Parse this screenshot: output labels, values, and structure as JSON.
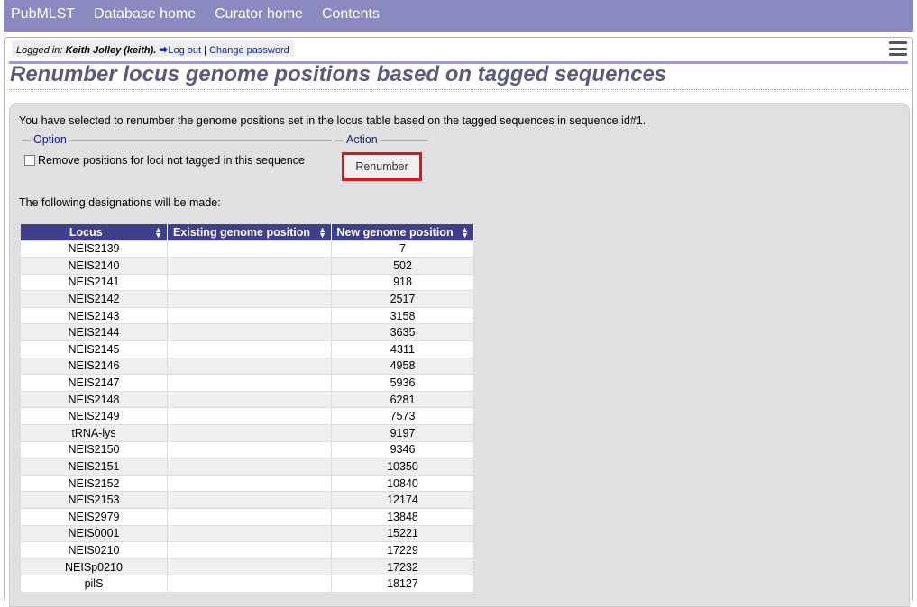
{
  "nav": {
    "items": [
      "PubMLST",
      "Database home",
      "Curator home",
      "Contents"
    ]
  },
  "login": {
    "label": "Logged in:",
    "user": "Keith Jolley (keith).",
    "logout": "Log out",
    "separator": "|",
    "change_password": "Change password"
  },
  "page_title": "Renumber locus genome positions based on tagged sequences",
  "intro_text": "You have selected to renumber the genome positions set in the locus table based on the tagged sequences in sequence id#1.",
  "option": {
    "legend": "Option",
    "checkbox_label": "Remove positions for loci not tagged in this sequence",
    "checked": false
  },
  "action": {
    "legend": "Action",
    "button_label": "Renumber"
  },
  "designations_text": "The following designations will be made:",
  "table": {
    "headers": [
      "Locus",
      "Existing genome position",
      "New genome position"
    ],
    "rows": [
      {
        "locus": "NEIS2139",
        "existing": "",
        "new": "7"
      },
      {
        "locus": "NEIS2140",
        "existing": "",
        "new": "502"
      },
      {
        "locus": "NEIS2141",
        "existing": "",
        "new": "918"
      },
      {
        "locus": "NEIS2142",
        "existing": "",
        "new": "2517"
      },
      {
        "locus": "NEIS2143",
        "existing": "",
        "new": "3158"
      },
      {
        "locus": "NEIS2144",
        "existing": "",
        "new": "3635"
      },
      {
        "locus": "NEIS2145",
        "existing": "",
        "new": "4311"
      },
      {
        "locus": "NEIS2146",
        "existing": "",
        "new": "4958"
      },
      {
        "locus": "NEIS2147",
        "existing": "",
        "new": "5936"
      },
      {
        "locus": "NEIS2148",
        "existing": "",
        "new": "6281"
      },
      {
        "locus": "NEIS2149",
        "existing": "",
        "new": "7573"
      },
      {
        "locus": "tRNA-lys",
        "existing": "",
        "new": "9197"
      },
      {
        "locus": "NEIS2150",
        "existing": "",
        "new": "9346"
      },
      {
        "locus": "NEIS2151",
        "existing": "",
        "new": "10350"
      },
      {
        "locus": "NEIS2152",
        "existing": "",
        "new": "10840"
      },
      {
        "locus": "NEIS2153",
        "existing": "",
        "new": "12174"
      },
      {
        "locus": "NEIS2979",
        "existing": "",
        "new": "13848"
      },
      {
        "locus": "NEIS0001",
        "existing": "",
        "new": "15221"
      },
      {
        "locus": "NEIS0210",
        "existing": "",
        "new": "17229"
      },
      {
        "locus": "NEISp0210",
        "existing": "",
        "new": "17232"
      },
      {
        "locus": "pilS",
        "existing": "",
        "new": "18127"
      }
    ]
  },
  "colors": {
    "nav_bg": "#8a8ac0",
    "table_header_bg": "#3f3f8c",
    "title_color": "#5a5a7c",
    "highlight_border": "#e0141f"
  },
  "icons": [
    "logout-icon",
    "hamburger-menu-icon",
    "sort-icon"
  ]
}
